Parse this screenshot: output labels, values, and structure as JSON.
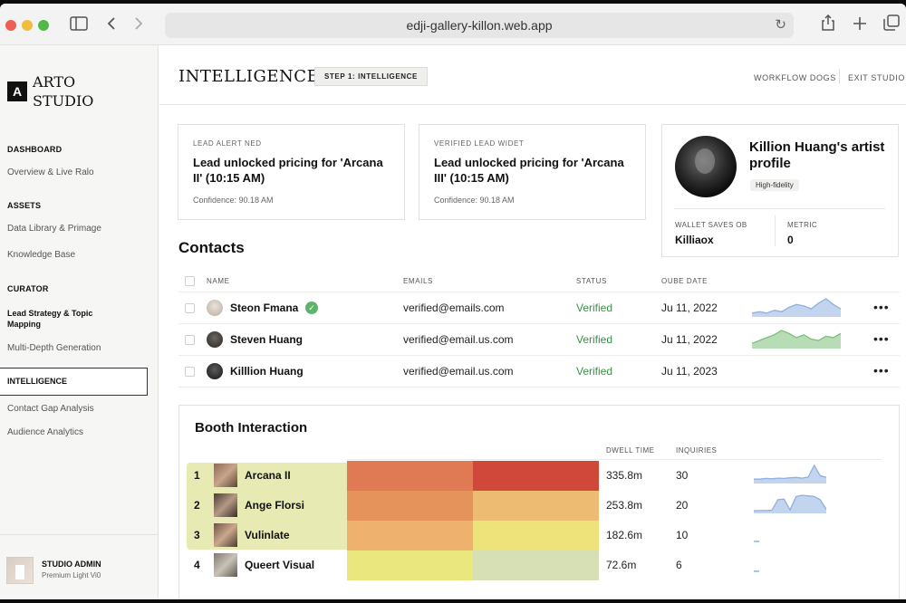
{
  "browser": {
    "url": "edji-gallery-killon.web.app",
    "icons": {
      "sidebar": "sidebar-icon",
      "back": "chevron-left-icon",
      "forward": "chevron-right-icon",
      "reload": "reload-icon",
      "share": "share-icon",
      "new_tab": "plus-icon",
      "tabs": "tabs-icon"
    }
  },
  "sidebar": {
    "logo_mark": "A",
    "logo_line1": "ARTO",
    "logo_line2": "STUDIO",
    "sections": [
      {
        "heading": "DASHBOARD",
        "items": [
          "Overview & Live Ralo"
        ]
      },
      {
        "heading": "ASSETS",
        "items": [
          "Data Library & Primage",
          "Knowledge Base"
        ]
      },
      {
        "heading": "CURATOR",
        "items": [
          "Lead Strategy & Topic Mapping",
          "Multi-Depth Generation"
        ]
      }
    ],
    "active_item": "INTELLIGENCE",
    "after_items": [
      "Contact Gap Analysis",
      "Audience Analytics"
    ],
    "footer": {
      "name": "STUDIO ADMIN",
      "subtitle": "Premium Light Vi0"
    }
  },
  "header": {
    "title": "INTELLIGENCE",
    "step": "STEP 1: INTELLIGENCE",
    "links": [
      "WORKFLOW DOGS",
      "EXIT STUDIO"
    ]
  },
  "lead_cards": [
    {
      "label": "LEAD ALERT NED",
      "headline": "Lead unlocked pricing for 'Arcana II' (10:15 AM)",
      "confidence": "Confidence: 90.18 AM"
    },
    {
      "label": "VERIFIED LEAD WIDET",
      "headline": "Lead unlocked pricing for 'Arcana III' (10:15 AM)",
      "confidence": "Confidence: 90.18 AM"
    }
  ],
  "profile": {
    "name": "Killion Huang's artist profile",
    "badge": "High-fidelity",
    "metrics": [
      {
        "label": "WALLET SAVES OB",
        "value": "Killiaox"
      },
      {
        "label": "METRIC",
        "value": "0"
      }
    ]
  },
  "contacts": {
    "title": "Contacts",
    "columns": [
      "NAME",
      "EMAILS",
      "STATUS",
      "OUBE DATE"
    ],
    "rows": [
      {
        "name": "Steon Fmana",
        "email": "verified@emails.com",
        "status": "Verified",
        "date": "Ju 11, 2022",
        "trend": [
          2,
          3,
          2,
          4,
          3,
          6,
          8,
          7,
          5,
          9,
          12,
          8,
          5
        ],
        "trend_color": "#8fb0e0"
      },
      {
        "name": "Steven Huang",
        "email": "verified@email.us.com",
        "status": "Verified",
        "date": "Ju 11, 2022",
        "trend": [
          3,
          5,
          7,
          9,
          12,
          10,
          7,
          9,
          6,
          5,
          8,
          7,
          10
        ],
        "trend_color": "#7cc07a"
      },
      {
        "name": "Killlion Huang",
        "email": "verified@email.us.com",
        "status": "Verified",
        "date": "Ju 11, 2023"
      }
    ]
  },
  "booth": {
    "title": "Booth Interaction",
    "columns": [
      "DWELL TIME",
      "INQUIRIES"
    ],
    "rows": [
      {
        "rank": "1",
        "name": "Arcana II",
        "dwell": "335.8m",
        "inquiries": "30",
        "heat": [
          "#e07a55",
          "#d0483a"
        ],
        "trend": [
          1,
          1,
          1.2,
          1.1,
          1.3,
          1.2,
          1.4,
          1.5,
          1.3,
          1.6,
          5,
          2,
          1.5
        ],
        "trend_color": "#8fb0e0"
      },
      {
        "rank": "2",
        "name": "Ange Florsi",
        "dwell": "253.8m",
        "inquiries": "20",
        "heat": [
          "#e6935b",
          "#eebb72"
        ],
        "trend": [
          0.5,
          0.6,
          0.6,
          0.7,
          4,
          4.2,
          0.8,
          5,
          5.4,
          5.2,
          5,
          4,
          1
        ],
        "trend_color": "#8fb0e0"
      },
      {
        "rank": "3",
        "name": "Vulinlate",
        "dwell": "182.6m",
        "inquiries": "10",
        "heat": [
          "#eeb16e",
          "#eee37b"
        ],
        "trend": [
          0.4,
          0.4
        ],
        "trend_color": "#8fb0e0"
      },
      {
        "rank": "4",
        "name": "Queert Visual",
        "dwell": "72.6m",
        "inquiries": "6",
        "heat": [
          "#eae77f",
          "#d7e0b4"
        ],
        "trend": [
          0.3,
          0.3
        ],
        "trend_color": "#8fb0e0"
      }
    ]
  }
}
